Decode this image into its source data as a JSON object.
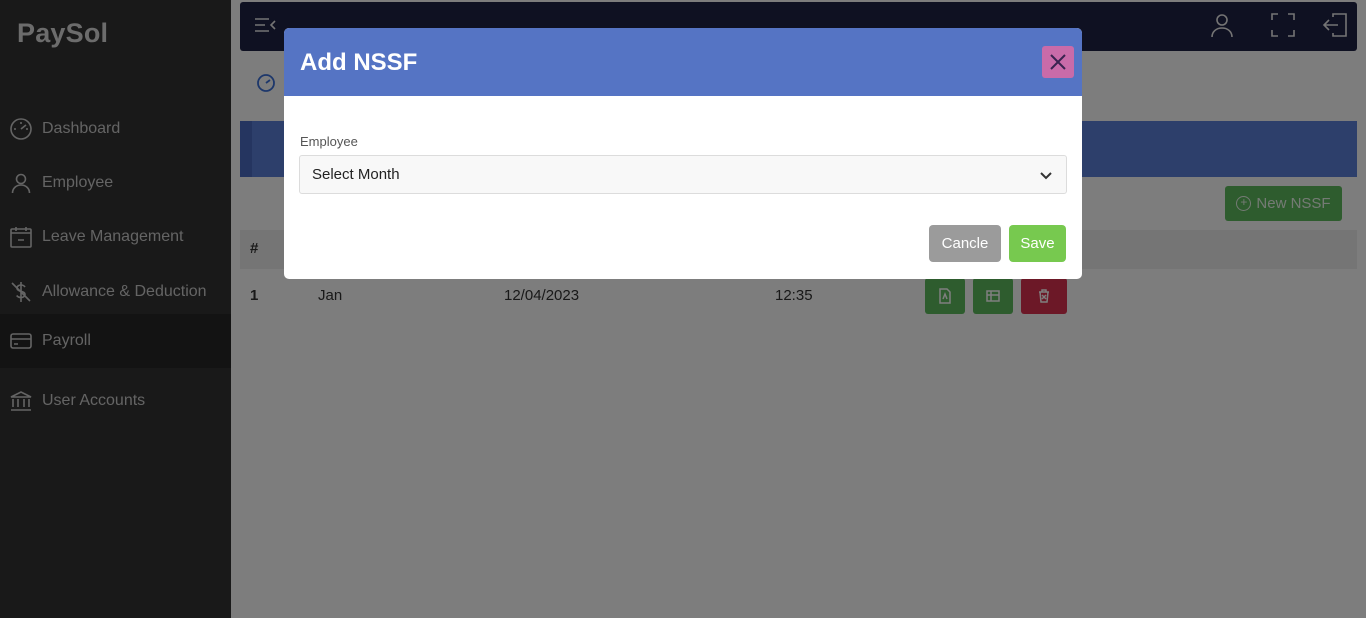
{
  "app": {
    "logo": "PaySol"
  },
  "sidebar": {
    "items": [
      {
        "label": "Dashboard",
        "icon": "gauge-icon"
      },
      {
        "label": "Employee",
        "icon": "user-icon"
      },
      {
        "label": "Leave Management",
        "icon": "calendar-icon"
      },
      {
        "label": "Allowance & Deduction",
        "icon": "dollar-icon"
      },
      {
        "label": "Payroll",
        "icon": "card-icon",
        "active": true
      },
      {
        "label": "User Accounts",
        "icon": "bank-icon"
      }
    ]
  },
  "header": {
    "icons": [
      "menu-collapse-icon",
      "user-icon",
      "fullscreen-icon",
      "logout-icon"
    ]
  },
  "page": {
    "new_button_label": "New NSSF",
    "table": {
      "headers": [
        "#"
      ],
      "rows": [
        {
          "num": "1",
          "month": "Jan",
          "date": "12/04/2023",
          "time": "12:35"
        }
      ]
    }
  },
  "modal": {
    "title": "Add NSSF",
    "field_label": "Employee",
    "select_value": "Select Month",
    "cancel_label": "Cancle",
    "save_label": "Save"
  },
  "colors": {
    "sidebar": "#333333",
    "topbar": "#1f2245",
    "modal_header": "#5574c4",
    "success": "#5cb85c",
    "danger": "#d9304f",
    "close": "#c96ba9"
  }
}
